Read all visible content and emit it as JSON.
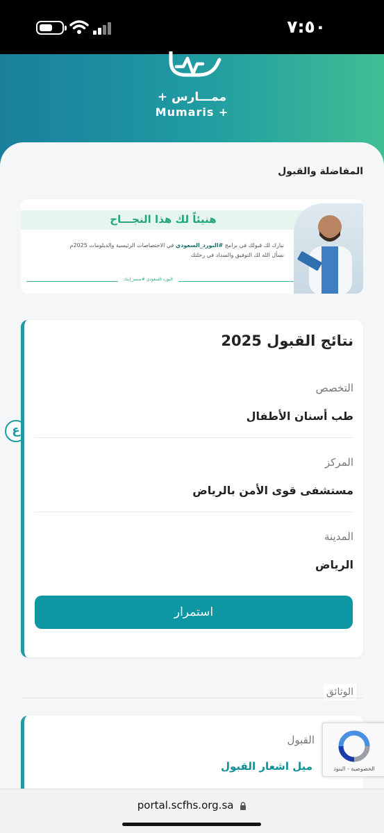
{
  "status": {
    "time": "٧:٥٠"
  },
  "header": {
    "brand_ar": "ممـــارس +",
    "brand_en": "Mumaris +"
  },
  "page": {
    "section_title": "المفاضلة والقبول"
  },
  "banner": {
    "headline": "هنيئاً لك هذا النجـــاح",
    "line1_a": "نبارك لك قبولك في برامج ",
    "line1_tag": "#البورد_السعودي",
    "line1_b": " في الاختصاصات الرئيسية والدبلومات 2025م",
    "line2": "نسأل الله لك التوفيق والسداد في رحلتك",
    "footer": "البورد السعودي #صمم_إبنك"
  },
  "results": {
    "title": "نتائج القبول 2025",
    "specialty_label": "التخصص",
    "specialty_value": "طب أسنان الأطفال",
    "center_label": "المركز",
    "center_value": "مستشفى قوى الأمن بالرياض",
    "city_label": "المدينة",
    "city_value": "الرياض",
    "continue_label": "استمرار"
  },
  "side_badge": "ع",
  "documents": {
    "title": "الوثائق",
    "item_label": "القبول",
    "item_link": "ميل اشعار القبول"
  },
  "recaptcha": {
    "text": "الخصوصية - البنود"
  },
  "browser": {
    "url": "portal.scfhs.org.sa"
  },
  "colors": {
    "accent": "#0e97a2",
    "brand_green": "#24a57d",
    "header_start": "#1a7f9c",
    "header_end": "#3fbf95"
  }
}
